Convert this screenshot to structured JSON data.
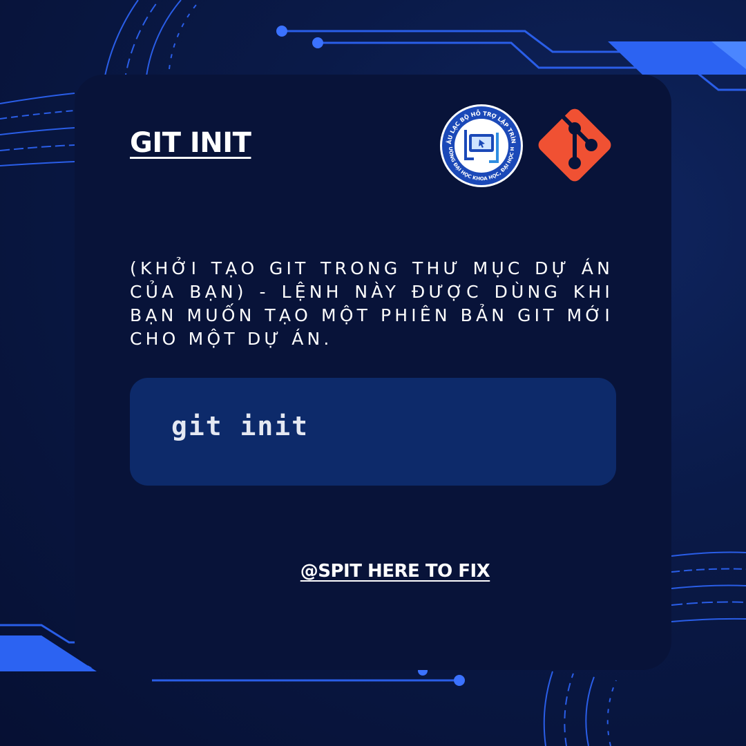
{
  "title": "GIT INIT",
  "description": "(KHỞI TẠO GIT TRONG THƯ MỤC DỰ ÁN CỦA BẠN) - LỆNH NÀY ĐƯỢC DÙNG KHI BẠN MUỐN TẠO MỘT PHIÊN BẢN GIT MỚI CHO MỘT DỰ ÁN.",
  "code": "git init",
  "handle": "@SPIT HERE TO FIX",
  "logos": {
    "club": {
      "icon": "club-logo",
      "top_text": "CÂU LẠC BỘ HỖ TRỢ LẬP TRÌNH",
      "bottom_text": "TRƯỜNG ĐẠI HỌC KHOA HỌC, ĐẠI HỌC HUẾ"
    },
    "git": {
      "icon": "git-logo",
      "color": "#f05133"
    }
  },
  "colors": {
    "background": "#07133a",
    "card": "#081339",
    "code_box": "#0d2a6a",
    "accent": "#2f6bff",
    "text": "#ffffff"
  }
}
